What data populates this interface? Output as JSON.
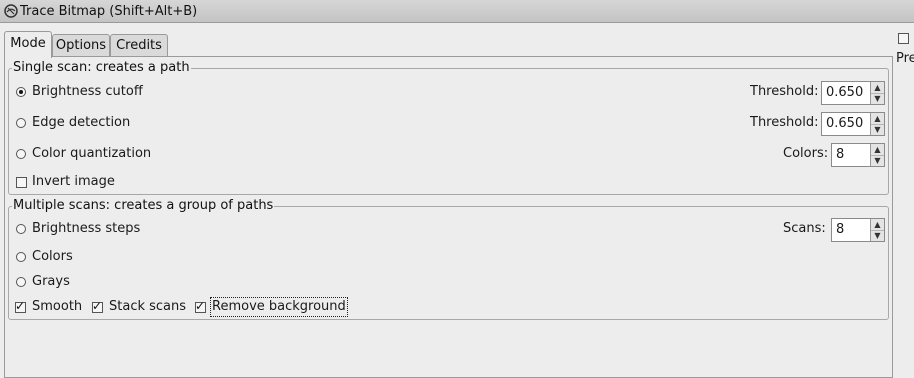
{
  "window": {
    "title": "Trace Bitmap (Shift+Alt+B)"
  },
  "tabs": [
    {
      "label": "Mode",
      "active": true
    },
    {
      "label": "Options",
      "active": false
    },
    {
      "label": "Credits",
      "active": false
    }
  ],
  "single_scan": {
    "legend": "Single scan: creates a path",
    "brightness_cutoff": {
      "label": "Brightness cutoff",
      "selected": true,
      "threshold_label": "Threshold:",
      "threshold_value": "0.650"
    },
    "edge_detection": {
      "label": "Edge detection",
      "selected": false,
      "threshold_label": "Threshold:",
      "threshold_value": "0.650"
    },
    "color_quantization": {
      "label": "Color quantization",
      "selected": false,
      "colors_label": "Colors:",
      "colors_value": "8"
    },
    "invert_image": {
      "label": "Invert image",
      "checked": false
    }
  },
  "multiple_scans": {
    "legend": "Multiple scans: creates a group of paths",
    "brightness_steps": {
      "label": "Brightness steps",
      "selected": false,
      "scans_label": "Scans:",
      "scans_value": "8"
    },
    "colors": {
      "label": "Colors",
      "selected": false
    },
    "grays": {
      "label": "Grays",
      "selected": false
    },
    "smooth": {
      "label": "Smooth",
      "checked": true
    },
    "stack_scans": {
      "label": "Stack scans",
      "checked": true
    },
    "remove_background": {
      "label": "Remove background",
      "checked": true
    }
  },
  "preview": {
    "label_partial": "Pre",
    "checked": false
  },
  "icons": {
    "title": "trace-bitmap-icon",
    "spin_up": "arrow-up-icon",
    "spin_down": "arrow-down-icon"
  },
  "colors": {
    "titlebar": "#c9c9c9",
    "window_bg": "#ededed",
    "frame_border": "#a8a8a8"
  }
}
